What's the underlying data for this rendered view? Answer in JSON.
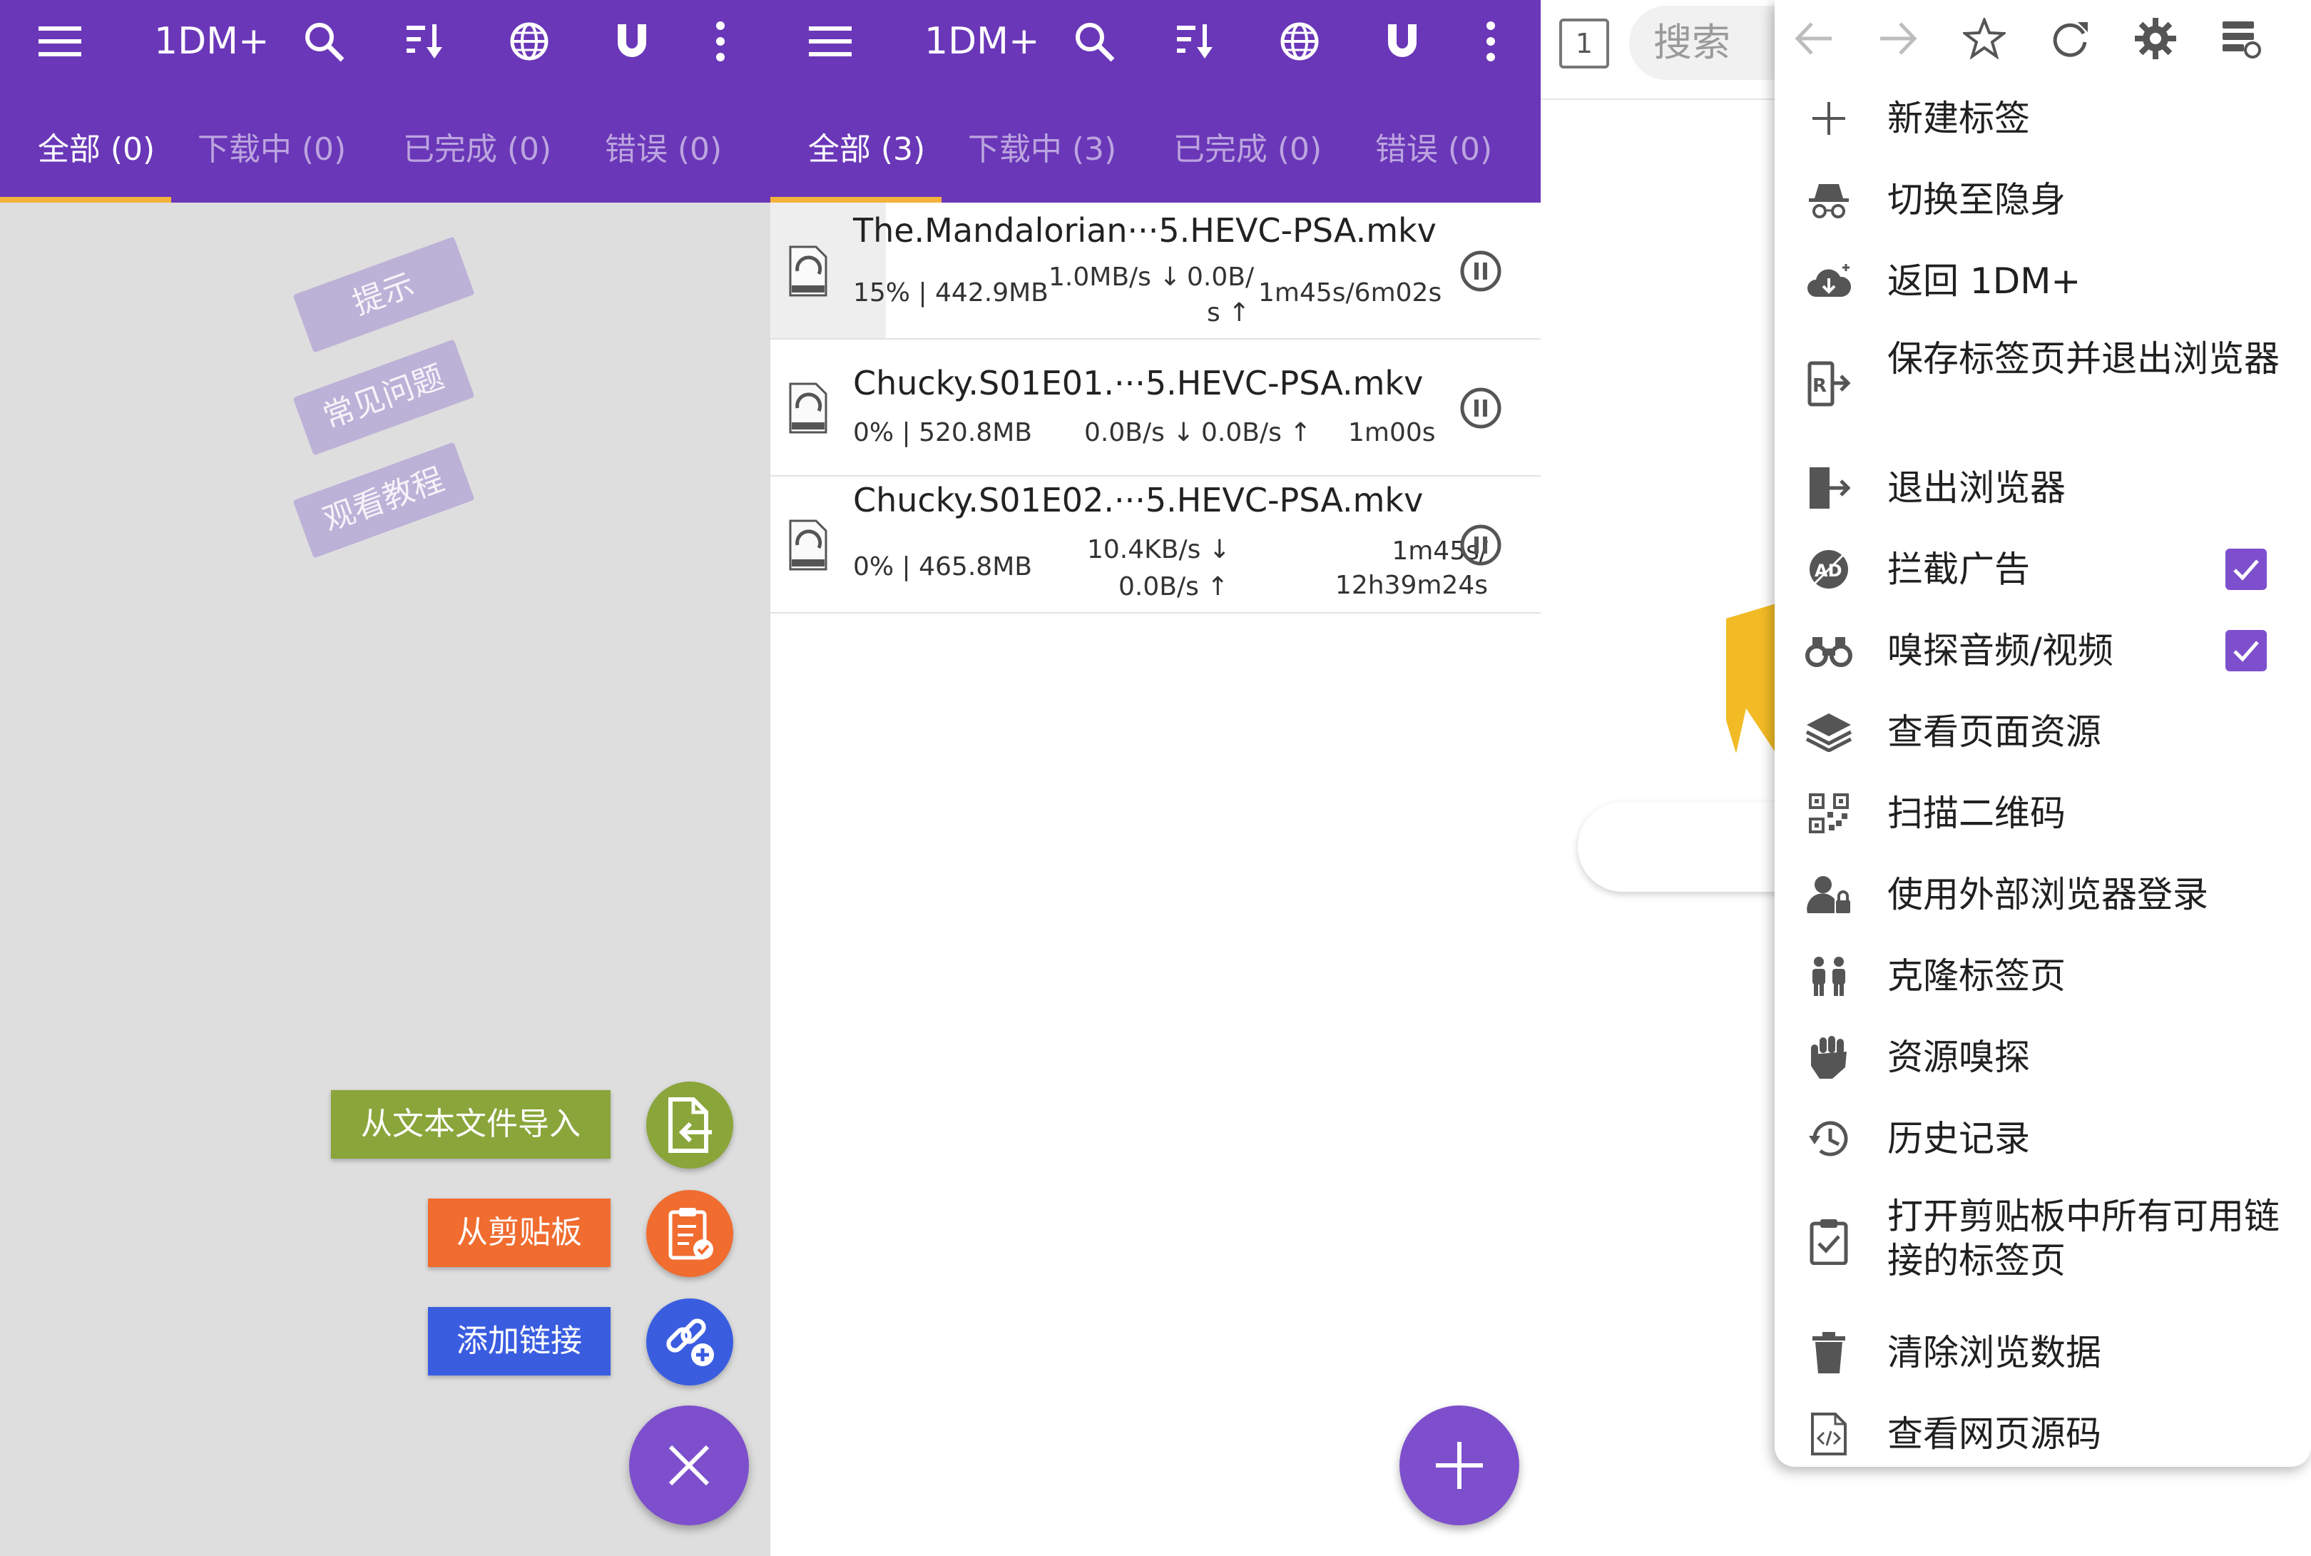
{
  "colors": {
    "appbar": "#6a37b8",
    "tab_indicator": "#f4b23c",
    "fab": "#7e4fcd",
    "import_green": "#8aa53a",
    "clipboard_orange": "#f06c2f",
    "link_blue": "#3a5de0",
    "left_background": "#dedede"
  },
  "left_panel": {
    "app_title": "1DM+",
    "tabs": [
      {
        "label": "全部 (0)",
        "active": true
      },
      {
        "label": "下载中 (0)",
        "active": false
      },
      {
        "label": "已完成 (0)",
        "active": false
      },
      {
        "label": "错误 (0)",
        "active": false
      }
    ],
    "hints": [
      "提示",
      "常见问题",
      "观看教程"
    ],
    "fab_actions": [
      {
        "label": "从文本文件导入",
        "icon": "file-import-icon"
      },
      {
        "label": "从剪贴板",
        "icon": "clipboard-check-icon"
      },
      {
        "label": "添加链接",
        "icon": "link-add-icon"
      }
    ]
  },
  "middle_panel": {
    "app_title": "1DM+",
    "tabs": [
      {
        "label": "全部 (3)",
        "active": true
      },
      {
        "label": "下载中 (3)",
        "active": false
      },
      {
        "label": "已完成 (0)",
        "active": false
      },
      {
        "label": "错误 (0)",
        "active": false
      }
    ],
    "downloads": [
      {
        "name": "The.Mandalorian···5.HEVC-PSA.mkv",
        "progress_size": "15% | 442.9MB",
        "progress": 0.15,
        "down_speed": "1.0MB/s",
        "up_speed_line1": "0.0B/",
        "up_speed_line2": "s",
        "time": "1m45s/6m02s"
      },
      {
        "name": "Chucky.S01E01.···5.HEVC-PSA.mkv",
        "progress_size": "0% | 520.8MB",
        "progress": 0,
        "down_speed": "0.0B/s",
        "up_speed": "0.0B/s",
        "time": "1m00s"
      },
      {
        "name": "Chucky.S01E02.···5.HEVC-PSA.mkv",
        "progress_size": "0% | 465.8MB",
        "progress": 0,
        "down_speed": "10.4KB/s",
        "up_speed": "0.0B/s",
        "time_line1": "1m45s/",
        "time_line2": "12h39m24s"
      }
    ]
  },
  "right_panel": {
    "tab_count": "1",
    "search_placeholder": "搜索",
    "menu_items": [
      {
        "label": "新建标签",
        "icon": "plus-icon"
      },
      {
        "label": "切换至隐身",
        "icon": "incognito-icon"
      },
      {
        "label": "返回 1DM+",
        "icon": "cloud-download-icon"
      },
      {
        "label": "保存标签页并退出浏览器",
        "icon": "save-exit-icon"
      },
      {
        "label": "退出浏览器",
        "icon": "exit-icon"
      },
      {
        "label": "拦截广告",
        "icon": "ad-block-icon",
        "checked": true
      },
      {
        "label": "嗅探音频/视频",
        "icon": "binoculars-icon",
        "checked": true
      },
      {
        "label": "查看页面资源",
        "icon": "layers-icon"
      },
      {
        "label": "扫描二维码",
        "icon": "qr-code-icon"
      },
      {
        "label": "使用外部浏览器登录",
        "icon": "user-lock-icon"
      },
      {
        "label": "克隆标签页",
        "icon": "people-icon"
      },
      {
        "label": "资源嗅探",
        "icon": "fist-icon"
      },
      {
        "label": "历史记录",
        "icon": "history-icon"
      },
      {
        "label": "打开剪贴板中所有可用链接的标签页",
        "icon": "clipboard-check-icon"
      },
      {
        "label": "清除浏览数据",
        "icon": "trash-icon"
      },
      {
        "label": "查看网页源码",
        "icon": "source-code-icon"
      }
    ]
  }
}
